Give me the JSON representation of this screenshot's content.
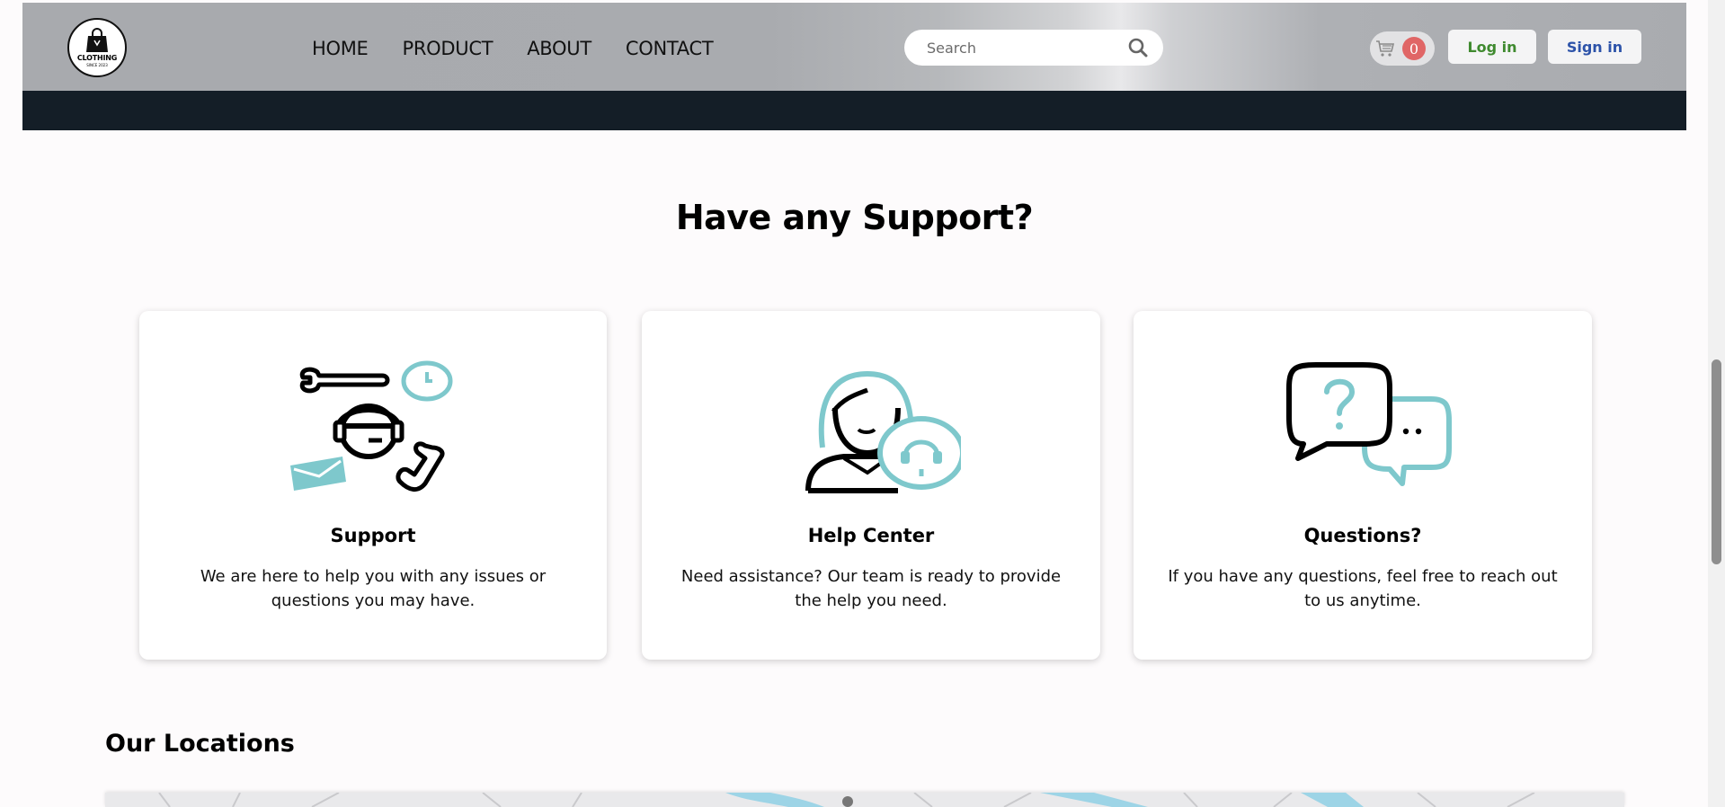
{
  "nav": {
    "logo": {
      "text": "CLOTHING",
      "sub": "SINCE 2023"
    },
    "links": [
      "HOME",
      "PRODUCT",
      "ABOUT",
      "CONTACT"
    ],
    "search": {
      "placeholder": "Search",
      "icon": "search-icon"
    },
    "cart": {
      "count": "0",
      "icon": "cart-icon"
    },
    "login_label": "Log in",
    "signin_label": "Sign in"
  },
  "support": {
    "title": "Have any Support?",
    "cards": [
      {
        "title": "Support",
        "description": "We are here to help you with any issues or questions you may have.",
        "icon": "support-tools-icon"
      },
      {
        "title": "Help Center",
        "description": "Need assistance? Our team is ready to provide the help you need.",
        "icon": "help-center-agent-icon"
      },
      {
        "title": "Questions?",
        "description": "If you have any questions, feel free to reach out to us anytime.",
        "icon": "question-chat-icon"
      }
    ]
  },
  "locations": {
    "title": "Our Locations"
  },
  "colors": {
    "accent": "#7ec8cc",
    "dark_band": "#141e27",
    "login": "#3f8a2f",
    "signin": "#2d53a9",
    "badge": "#e06666"
  }
}
